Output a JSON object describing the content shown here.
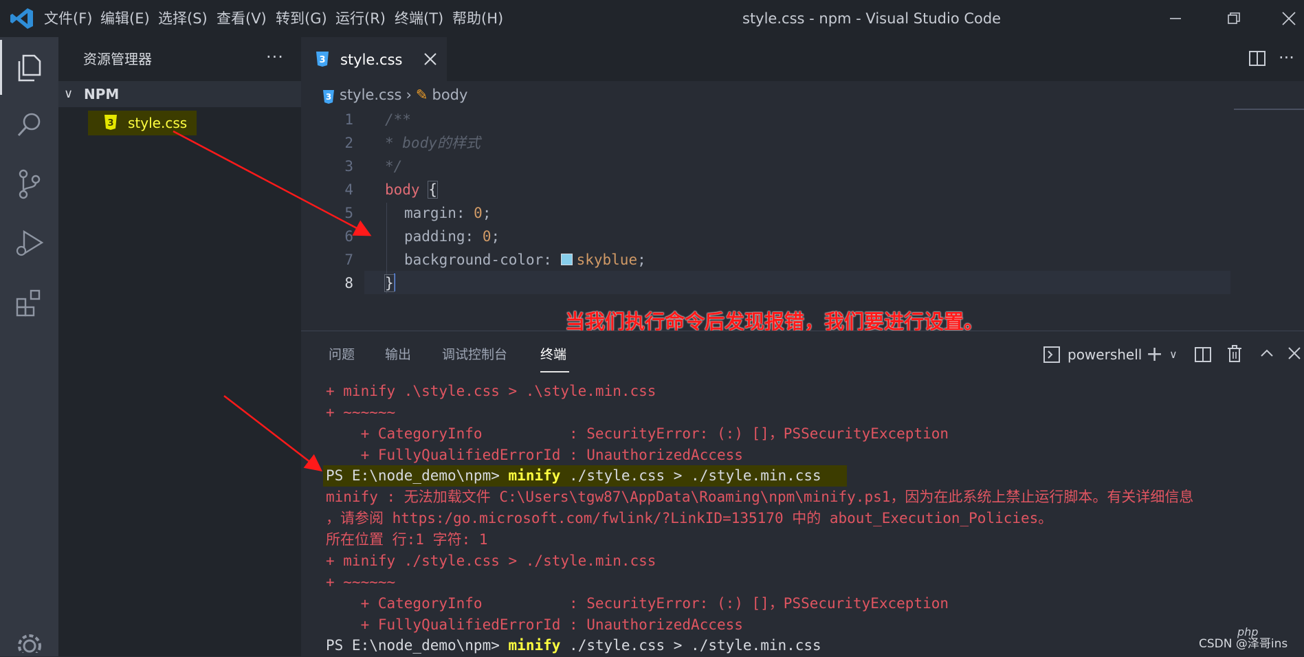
{
  "titlebar": {
    "menu": [
      "文件(F)",
      "编辑(E)",
      "选择(S)",
      "查看(V)",
      "转到(G)",
      "运行(R)",
      "终端(T)",
      "帮助(H)"
    ],
    "title": "style.css - npm - Visual Studio Code"
  },
  "sidebar": {
    "title": "资源管理器",
    "more": "···",
    "folder": "NPM",
    "file": "style.css"
  },
  "editor": {
    "tab_label": "style.css",
    "breadcrumb_file": "style.css",
    "breadcrumb_symbol": "body",
    "line_numbers": [
      "1",
      "2",
      "3",
      "4",
      "5",
      "6",
      "7",
      "8"
    ],
    "lines": {
      "l1": "/**",
      "l2": "* body的样式",
      "l3": "*/",
      "l4_selector": "body",
      "l4_brace": "{",
      "l5_prop": "margin",
      "l5_val": "0",
      "l6_prop": "padding",
      "l6_val": "0",
      "l7_prop": "background-color",
      "l7_val": "skyblue",
      "l8": "}"
    },
    "swatch_color": "#87ceeb"
  },
  "annotation": "当我们执行命令后发现报错，我们要进行设置。",
  "panel": {
    "tabs": [
      "问题",
      "输出",
      "调试控制台",
      "终端"
    ],
    "terminal_name": "powershell",
    "terminal_lines": [
      "+ minify .\\style.css > .\\style.min.css",
      "+ ~~~~~~",
      "    + CategoryInfo          : SecurityError: (:) []，PSSecurityException",
      "    + FullyQualifiedErrorId : UnauthorizedAccess",
      "minify : 无法加载文件 C:\\Users\\tgw87\\AppData\\Roaming\\npm\\minify.ps1，因为在此系统上禁止运行脚本。有关详细信息",
      "，请参阅 https:/go.microsoft.com/fwlink/?LinkID=135170 中的 about_Execution_Policies。",
      "所在位置 行:1 字符: 1",
      "+ minify ./style.css > ./style.min.css",
      "+ ~~~~~~",
      "    + CategoryInfo          : SecurityError: (:) []，PSSecurityException",
      "    + FullyQualifiedErrorId : UnauthorizedAccess"
    ],
    "prompt1": "PS E:\\node_demo\\npm>",
    "cmd1": "minify",
    "args1": "./style.css > ./style.min.css",
    "prompt2": "PS E:\\node_demo\\npm>",
    "cmd2": "minify",
    "args2": "./style.css > ./style.min.css"
  },
  "watermark": "CSDN @泽哥ins",
  "watermark_php": "php",
  "colors": {
    "accent": "#528bff",
    "error": "#e05561",
    "highlight": "#ffff40",
    "annotation": "#ff1a1a"
  }
}
